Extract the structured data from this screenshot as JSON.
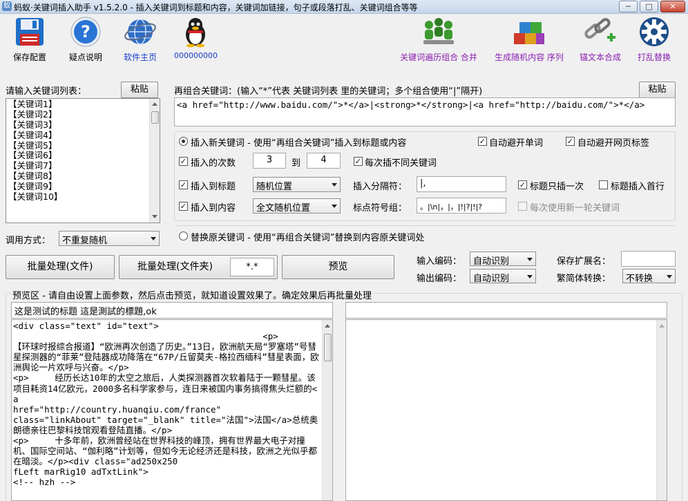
{
  "window": {
    "title": "蚂蚁·关键词插入助手 v1.5.2.0 - 插入关键词到标题和内容，关键词加链接，句子或段落打乱、关键词组合等等",
    "controls": {
      "minimize": "─",
      "maximize": "□",
      "close": "✕"
    }
  },
  "toolbar": {
    "left": [
      {
        "label": "保存配置",
        "icon": "floppy-disk-icon"
      },
      {
        "label": "疑点说明",
        "icon": "help-icon"
      },
      {
        "label": "软件主页",
        "icon": "globe-icon"
      },
      {
        "label": "000000000",
        "icon": "penguin-icon"
      }
    ],
    "right": [
      {
        "label": "关键词遍历组合 合并",
        "icon": "people-group-icon"
      },
      {
        "label": "生成随机内容 序列",
        "icon": "colored-cubes-icon"
      },
      {
        "label": "锚文本合成",
        "icon": "chain-link-icon"
      },
      {
        "label": "打乱替换",
        "icon": "gear-icon"
      }
    ]
  },
  "keywords_panel": {
    "label": "请输入关键词列表：",
    "paste_label": "粘贴",
    "items": [
      "【关键词1】",
      "【关键词2】",
      "【关键词3】",
      "【关键词4】",
      "【关键词5】",
      "【关键词6】",
      "【关键词7】",
      "【关键词8】",
      "【关键词9】",
      "【关键词10】"
    ],
    "call_mode_label": "调用方式：",
    "call_mode_value": "不重复随机"
  },
  "recombine": {
    "label": "再组合关键词：(输入“*”代表 关键词列表 里的关键词；多个组合使用“|”隔开)",
    "paste_label": "粘贴",
    "value": "<a href=\"http://www.baidu.com/\">*</a>|<strong>*</strong>|<a href=\"http://baidu.com/\">*</a>"
  },
  "insert_mode": {
    "radio_label": "插入新关键词 - 使用“再组合关键词”插入到标题或内容",
    "auto_avoid_word": "自动避开单词",
    "auto_avoid_tag": "自动避开网页标签",
    "times_label": "插入的次数",
    "times_from": "3",
    "to_label": "到",
    "times_to": "4",
    "diff_keyword": "每次插不同关键词",
    "insert_title_label": "插入到标题",
    "title_position": "随机位置",
    "separator_label": "插入分隔符：",
    "separator_value": "|,",
    "title_once": "标题只插一次",
    "title_first": "标题插入首行",
    "insert_content_label": "插入到内容",
    "content_position": "全文随机位置",
    "punct_label": "标点符号组：",
    "punct_value": "。|\\n|，|，|!|?|!|?",
    "new_round": "每次使用新一轮关键词"
  },
  "replace_mode": {
    "radio_label": "替换原关键词 - 使用“再组合关键词”替换到内容原关键词处"
  },
  "actions": {
    "batch_file": "批量处理(文件)",
    "batch_folder": "批量处理(文件夹)",
    "ext_value": "*.*",
    "preview": "预览",
    "input_enc_label": "输入编码：",
    "input_enc_value": "自动识别",
    "output_enc_label": "输出编码：",
    "output_enc_value": "自动识别",
    "save_ext_label": "保存扩展名：",
    "save_ext_value": "",
    "conv_label": "繁简体转换：",
    "conv_value": "不转换"
  },
  "preview": {
    "label": "预览区 - 请自由设置上面参数，然后点击预览，就知道设置效果了。确定效果后再批量处理",
    "title_left": "这是测试的标题 這是測試的標題,ok",
    "title_right": "",
    "content_left": "<div class=\"text\" id=\"text\">\n\t\t\t\t\t\t<p>\t【环球时报综合报道】“欧洲再次创造了历史。”13日，欧洲航天局“罗塞塔”号彗星探测器的“菲莱”登陆器成功降落在“67P/丘留莫夫-格拉西缅科”彗星表面，欧洲舆论一片欢呼与兴奋。</p>\n<p>\t经历长达10年的太空之旅后，人类探测器首次软着陆于一颗彗星。该项目耗资14亿欧元，2000多名科学家参与，连日来被国内事务搞得焦头烂额的<a\nhref=\"http://country.huanqiu.com/france\"\nclass=\"linkAbout\" target=\"_blank\" title=\"法国\">法国</a>总统奥朗德亲往巴黎科技馆观看登陆直播。</p>\n<p>\t十多年前，欧洲曾经站在世界科技的峰顶，拥有世界最大电子对撞机、国际空间站、“伽利略”计划等，但如今无论经济还是科技，欧洲之光似乎都在暗淡。</p><div class=\"ad250x250\nfLeft marRig10 adTxtLink\">\n<!-- hzh -->",
    "content_right": ""
  }
}
